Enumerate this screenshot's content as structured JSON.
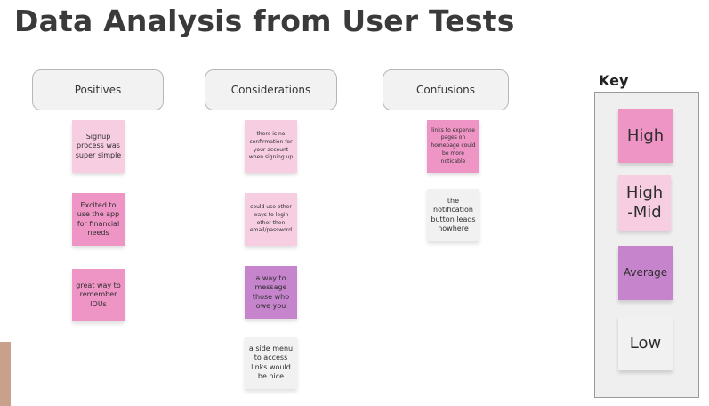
{
  "title": "Data Analysis from User Tests",
  "columns": [
    {
      "label": "Positives"
    },
    {
      "label": "Considerations"
    },
    {
      "label": "Confusions"
    }
  ],
  "notes": {
    "positives": [
      {
        "text": "Signup process was super simple",
        "level": "high-mid"
      },
      {
        "text": "Excited to use the app for financial needs",
        "level": "high"
      },
      {
        "text": "great way to remember IOUs",
        "level": "high"
      }
    ],
    "considerations": [
      {
        "text": "there is no confirmation for your account when signing up",
        "level": "high-mid"
      },
      {
        "text": "could use other ways to login other then email/password",
        "level": "high-mid"
      },
      {
        "text": "a way to message those who owe you",
        "level": "average"
      },
      {
        "text": "a side menu to access links would be nice",
        "level": "low"
      }
    ],
    "confusions": [
      {
        "text": "links to expense pages on homepage could be more noticable",
        "level": "high"
      },
      {
        "text": "the notification button leads nowhere",
        "level": "low"
      }
    ]
  },
  "key": {
    "label": "Key",
    "items": [
      {
        "text": "High",
        "color": "#ef95c5"
      },
      {
        "text": "High-Mid",
        "color": "#f7cde2"
      },
      {
        "text": "Average",
        "color": "#c684cc"
      },
      {
        "text": "Low",
        "color": "#f1f1f1"
      }
    ]
  }
}
